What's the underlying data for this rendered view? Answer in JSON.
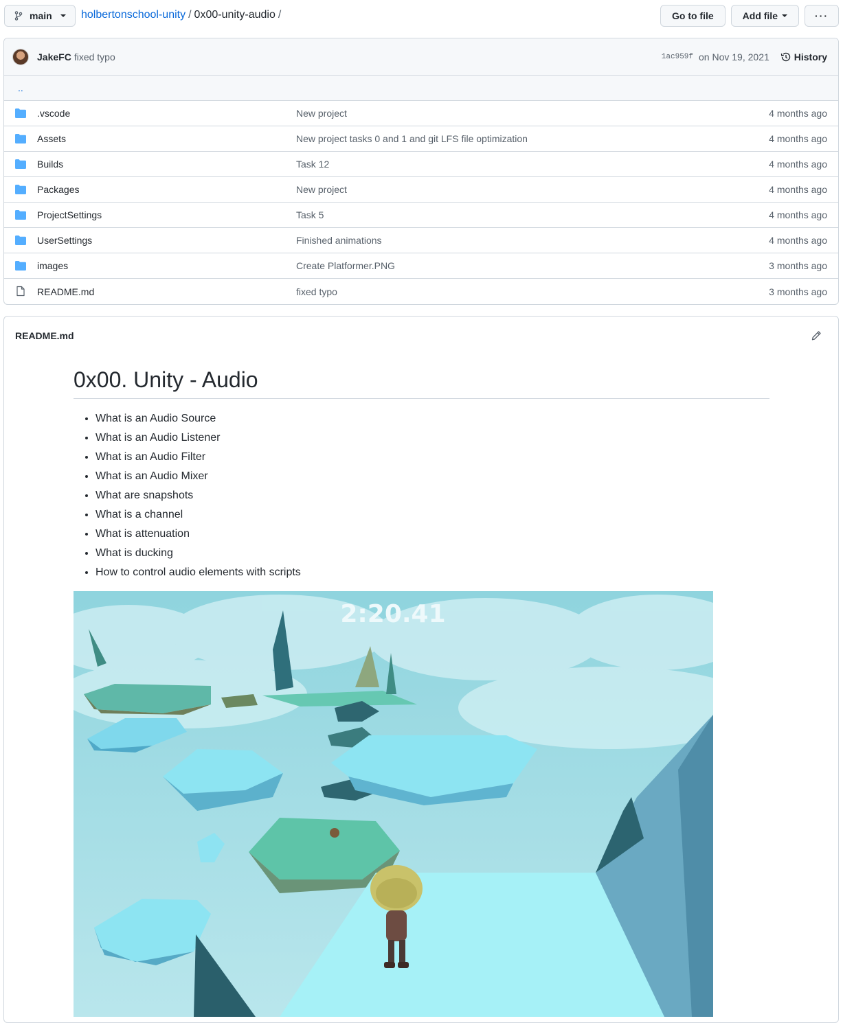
{
  "topbar": {
    "branch": "main",
    "repo": "holbertonschool-unity",
    "sep1": "/",
    "folder": "0x00-unity-audio",
    "sep2": "/",
    "goto_file": "Go to file",
    "add_file": "Add file",
    "more": "···"
  },
  "commit": {
    "author": "JakeFC",
    "message": "fixed typo",
    "sha": "1ac959f",
    "date": "on Nov 19, 2021",
    "history_label": "History"
  },
  "up_dir": "..",
  "files": [
    {
      "name": ".vscode",
      "commit": "New project",
      "age": "4 months ago",
      "type": "folder"
    },
    {
      "name": "Assets",
      "commit": "New project tasks 0 and 1 and git LFS file optimization",
      "age": "4 months ago",
      "type": "folder"
    },
    {
      "name": "Builds",
      "commit": "Task 12",
      "age": "4 months ago",
      "type": "folder"
    },
    {
      "name": "Packages",
      "commit": "New project",
      "age": "4 months ago",
      "type": "folder"
    },
    {
      "name": "ProjectSettings",
      "commit": "Task 5",
      "age": "4 months ago",
      "type": "folder"
    },
    {
      "name": "UserSettings",
      "commit": "Finished animations",
      "age": "4 months ago",
      "type": "folder"
    },
    {
      "name": "images",
      "commit": "Create Platformer.PNG",
      "age": "3 months ago",
      "type": "folder"
    },
    {
      "name": "README.md",
      "commit": "fixed typo",
      "age": "3 months ago",
      "type": "file"
    }
  ],
  "readme": {
    "filename": "README.md",
    "title": "0x00. Unity - Audio",
    "items": [
      "What is an Audio Source",
      "What is an Audio Listener",
      "What is an Audio Filter",
      "What is an Audio Mixer",
      "What are snapshots",
      "What is a channel",
      "What is attenuation",
      "What is ducking",
      "How to control audio elements with scripts"
    ],
    "game_timer": "2:20.41"
  },
  "colors": {
    "link": "#0969da",
    "folder": "#54aeff",
    "border": "#d0d7de",
    "header_bg": "#f6f8fa"
  }
}
